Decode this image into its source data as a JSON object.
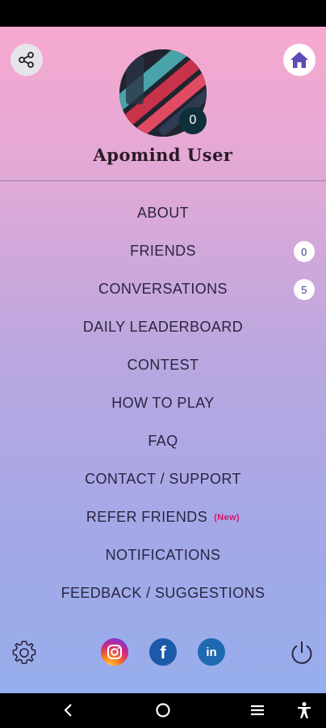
{
  "header": {
    "share_icon": "share-icon",
    "home_icon": "home-icon",
    "avatar_badge_count": "0",
    "username": "Apomind User"
  },
  "menu": {
    "items": [
      {
        "label": "ABOUT"
      },
      {
        "label": "FRIENDS",
        "badge": "0"
      },
      {
        "label": "CONVERSATIONS",
        "badge": "5"
      },
      {
        "label": "DAILY LEADERBOARD"
      },
      {
        "label": "CONTEST"
      },
      {
        "label": "HOW TO PLAY"
      },
      {
        "label": "FAQ"
      },
      {
        "label": "CONTACT / SUPPORT"
      },
      {
        "label": "REFER FRIENDS",
        "tag": "(New)"
      },
      {
        "label": "NOTIFICATIONS"
      },
      {
        "label": "FEEDBACK / SUGGESTIONS"
      }
    ]
  },
  "footer": {
    "settings_icon": "gear-icon",
    "social": [
      "instagram-icon",
      "facebook-icon",
      "linkedin-icon"
    ],
    "facebook_glyph": "f",
    "linkedin_glyph": "in",
    "power_icon": "power-icon"
  },
  "colors": {
    "gradient_top": "#f6a9cf",
    "gradient_bottom": "#97aeec",
    "new_tag": "#d0186a",
    "home_icon": "#5a4bb5"
  }
}
